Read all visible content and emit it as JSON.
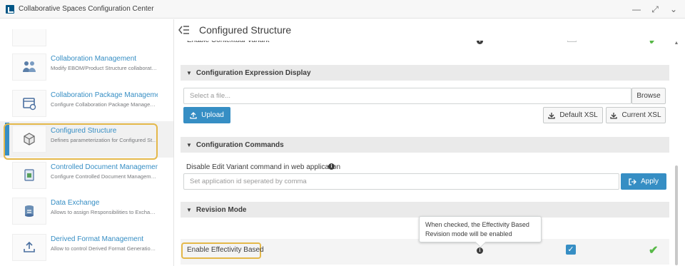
{
  "window": {
    "title": "Collaborative Spaces Configuration Center",
    "controls": {
      "minimize": "—",
      "maximize": "⤢",
      "chevron": "⌄"
    }
  },
  "sidebar": {
    "items": [
      {
        "title": "Collaboration Management",
        "desc": "Modify EBOM/Product Structure collaboratio...",
        "icon": "collaboration-users-icon"
      },
      {
        "title": "Collaboration Package Management",
        "desc": "Configure Collaboration Package Managem...",
        "icon": "package-icon"
      },
      {
        "title": "Configured Structure",
        "desc": "Defines parameterization for Configured Str...",
        "icon": "cube-structure-icon",
        "active": true
      },
      {
        "title": "Controlled Document Management",
        "desc": "Configure Controlled Document Managemen...",
        "icon": "document-icon"
      },
      {
        "title": "Data Exchange",
        "desc": "Allows to assign Responsibilities to Exchang...",
        "icon": "database-exchange-icon"
      },
      {
        "title": "Derived Format Management",
        "desc": "Allow to control Derived Format Generation ...",
        "icon": "upload-tray-icon"
      }
    ]
  },
  "main": {
    "title": "Configured Structure",
    "top_row_label": "Enable Contextual Variant",
    "sections": {
      "config_expression": {
        "title": "Configuration Expression Display",
        "file_placeholder": "Select a file...",
        "browse_label": "Browse",
        "upload_label": "Upload",
        "default_xsl_label": "Default XSL",
        "current_xsl_label": "Current XSL"
      },
      "config_commands": {
        "title": "Configuration Commands",
        "field_label": "Disable Edit Variant command in web application",
        "input_placeholder": "Set application id seperated by comma",
        "apply_label": "Apply"
      },
      "revision_mode": {
        "title": "Revision Mode",
        "row_label": "Enable Effectivity Based",
        "checked": true,
        "tooltip": "When checked, the Effectivity Based Revision mode will be enabled"
      }
    }
  },
  "colors": {
    "accent": "#368ec4",
    "success": "#57b847",
    "highlight": "#e4b84a"
  }
}
